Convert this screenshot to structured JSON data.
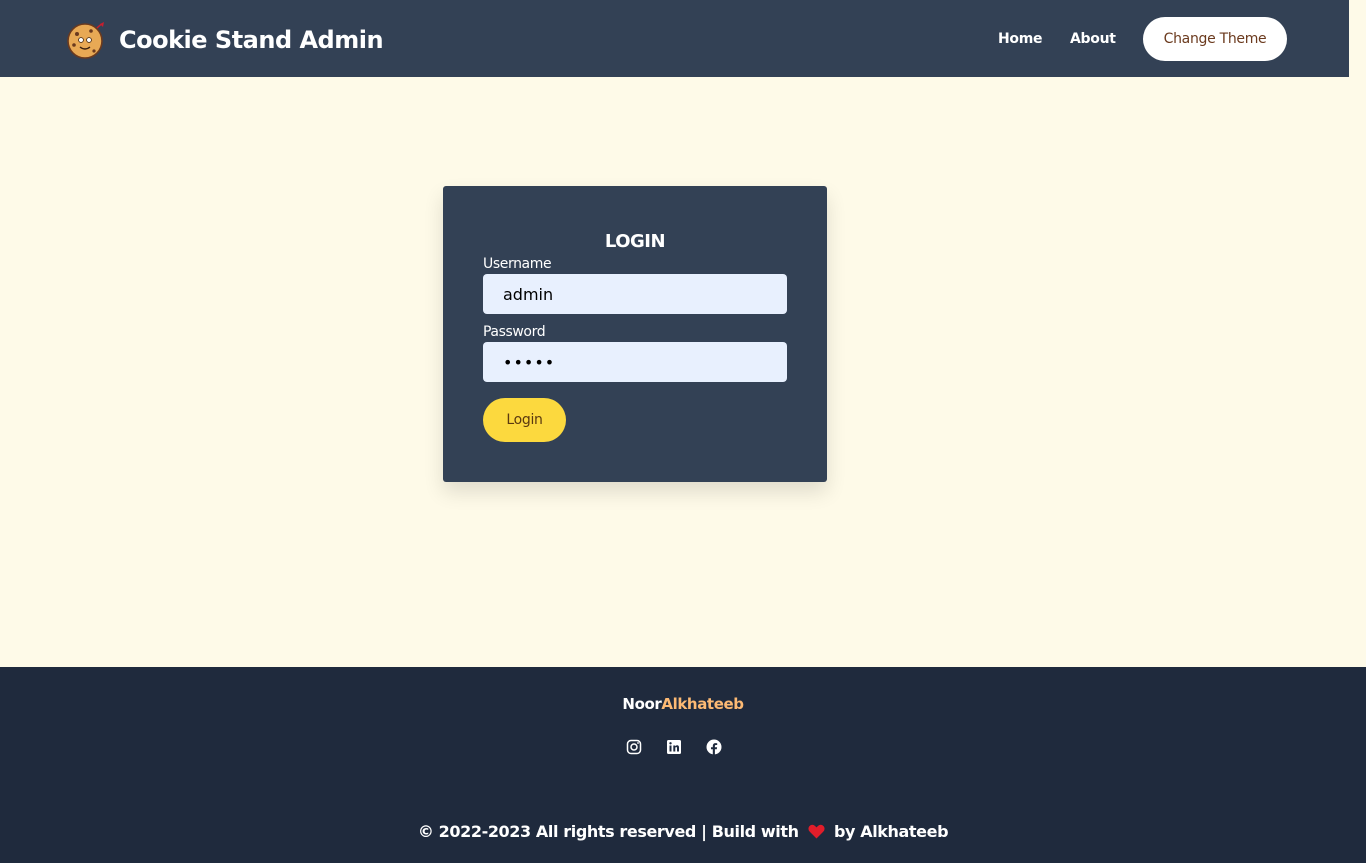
{
  "header": {
    "logo_icon": "cookie-mascot-icon",
    "title": "Cookie Stand Admin",
    "nav": {
      "home": "Home",
      "about": "About"
    },
    "theme_button": "Change Theme",
    "background_color": "#334155"
  },
  "login": {
    "title": "LOGIN",
    "username_label": "Username",
    "username_value": "admin",
    "password_label": "Password",
    "password_value": "•••••",
    "submit_label": "Login",
    "button_color": "#fcd93e"
  },
  "footer": {
    "brand_first": "Noor",
    "brand_last": "Alkhateeb",
    "brand_accent_color": "#fdba74",
    "social_icons": [
      "instagram-icon",
      "linkedin-icon",
      "facebook-icon"
    ],
    "copyright_prefix": "© 2022-2023 All rights reserved | Build with",
    "copyright_suffix": "by Alkhateeb",
    "heart_color": "#e11d2a"
  }
}
